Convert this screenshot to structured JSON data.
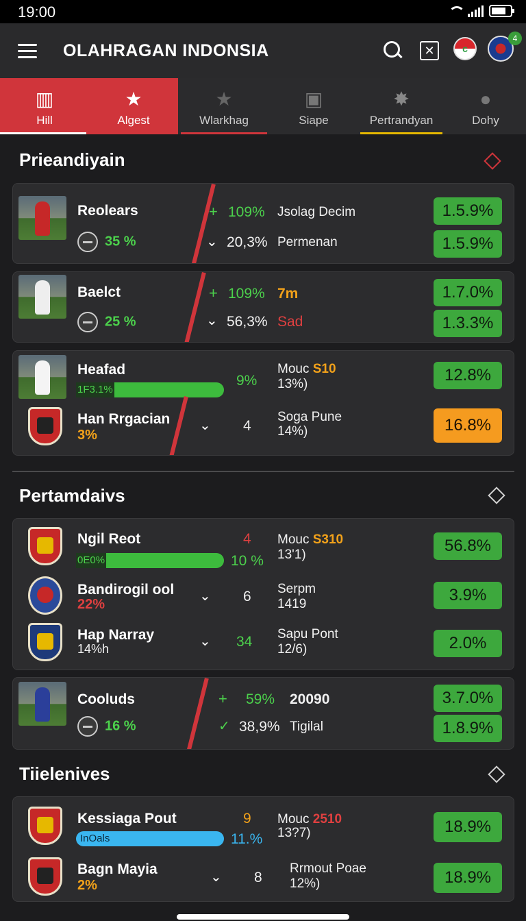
{
  "status": {
    "time": "19:00"
  },
  "app": {
    "title": "OLAHRAGAN INDONSIA"
  },
  "tabs": [
    {
      "label": "Hill",
      "icon": "stadium-icon",
      "glyph": "▥"
    },
    {
      "label": "Algest",
      "icon": "star-icon",
      "glyph": "★"
    },
    {
      "label": "Wlarkhag",
      "icon": "star-icon",
      "glyph": "★"
    },
    {
      "label": "Siape",
      "icon": "ticket-icon",
      "glyph": "▣"
    },
    {
      "label": "Pertrandyan",
      "icon": "burst-icon",
      "glyph": "✸"
    },
    {
      "label": "Dohy",
      "icon": "pin-icon",
      "glyph": "●"
    }
  ],
  "sections": {
    "s1": "Prieandiyain",
    "s2": "Pertamdaivs",
    "s3": "Tiielenives"
  },
  "cards": {
    "c1": {
      "name": "Reolears",
      "sub": "35 %",
      "up_pct": "109%",
      "up_label": "Jsolag Decim",
      "down_pct": "20,3%",
      "down_label": "Permenan",
      "pill1": "1.5.9%",
      "pill2": "1.5.9%"
    },
    "c2": {
      "name": "Baelct",
      "sub": "25 %",
      "up_pct": "109%",
      "up_label": "7m",
      "down_pct": "56,3%",
      "down_label": "Sad",
      "pill1": "1.7.0%",
      "pill2": "1.3.3%"
    },
    "c3a": {
      "name": "Heafad",
      "bar_text": "1F3.1%",
      "pct": "9%",
      "lbl1": "Mouc",
      "lbl1b": "S10",
      "lbl2": "13%)",
      "pill": "12.8%"
    },
    "c3b": {
      "name": "Han Rrgacian",
      "sub": "3%",
      "num": "4",
      "lbl1": "Soga Pune",
      "lbl2": "14%)",
      "pill": "16.8%"
    },
    "c4a": {
      "name": "Ngil Reot",
      "bar_text": "0E0%",
      "top_num": "4",
      "pct": "10 %",
      "lbl1": "Mouc",
      "lbl1b": "S310",
      "lbl2": "13'1)",
      "pill": "56.8%"
    },
    "c4b": {
      "name": "Bandirogil ool",
      "sub": "22%",
      "num": "6",
      "lbl1": "Serpm",
      "lbl2": "1419",
      "pill": "3.9%"
    },
    "c4c": {
      "name": "Hap Narray",
      "sub": "14%h",
      "num": "34",
      "lbl1": "Sapu Pont",
      "lbl2": "12/6)",
      "pill": "2.0%"
    },
    "c5": {
      "name": "Cooluds",
      "sub": "16 %",
      "up_pct": "59%",
      "up_label": "20090",
      "down_pct": "38,9%",
      "down_label": "Tigilal",
      "pill1": "3.7.0%",
      "pill2": "1.8.9%"
    },
    "c6a": {
      "name": "Kessiaga Pout",
      "bar_text": "InOals",
      "top_num": "9",
      "pct": "11.%",
      "lbl1": "Mouc",
      "lbl1b": "2510",
      "lbl2": "13?7)",
      "pill": "18.9%"
    },
    "c6b": {
      "name": "Bagn Mayia",
      "sub": "2%",
      "num": "8",
      "lbl1": "Rrmout Poae",
      "lbl2": "12%)",
      "pill": "18.9%"
    }
  },
  "colors": {
    "accent_red": "#d0353b",
    "green": "#3da83d",
    "orange": "#f59b1f",
    "blue": "#3ab6f0"
  }
}
